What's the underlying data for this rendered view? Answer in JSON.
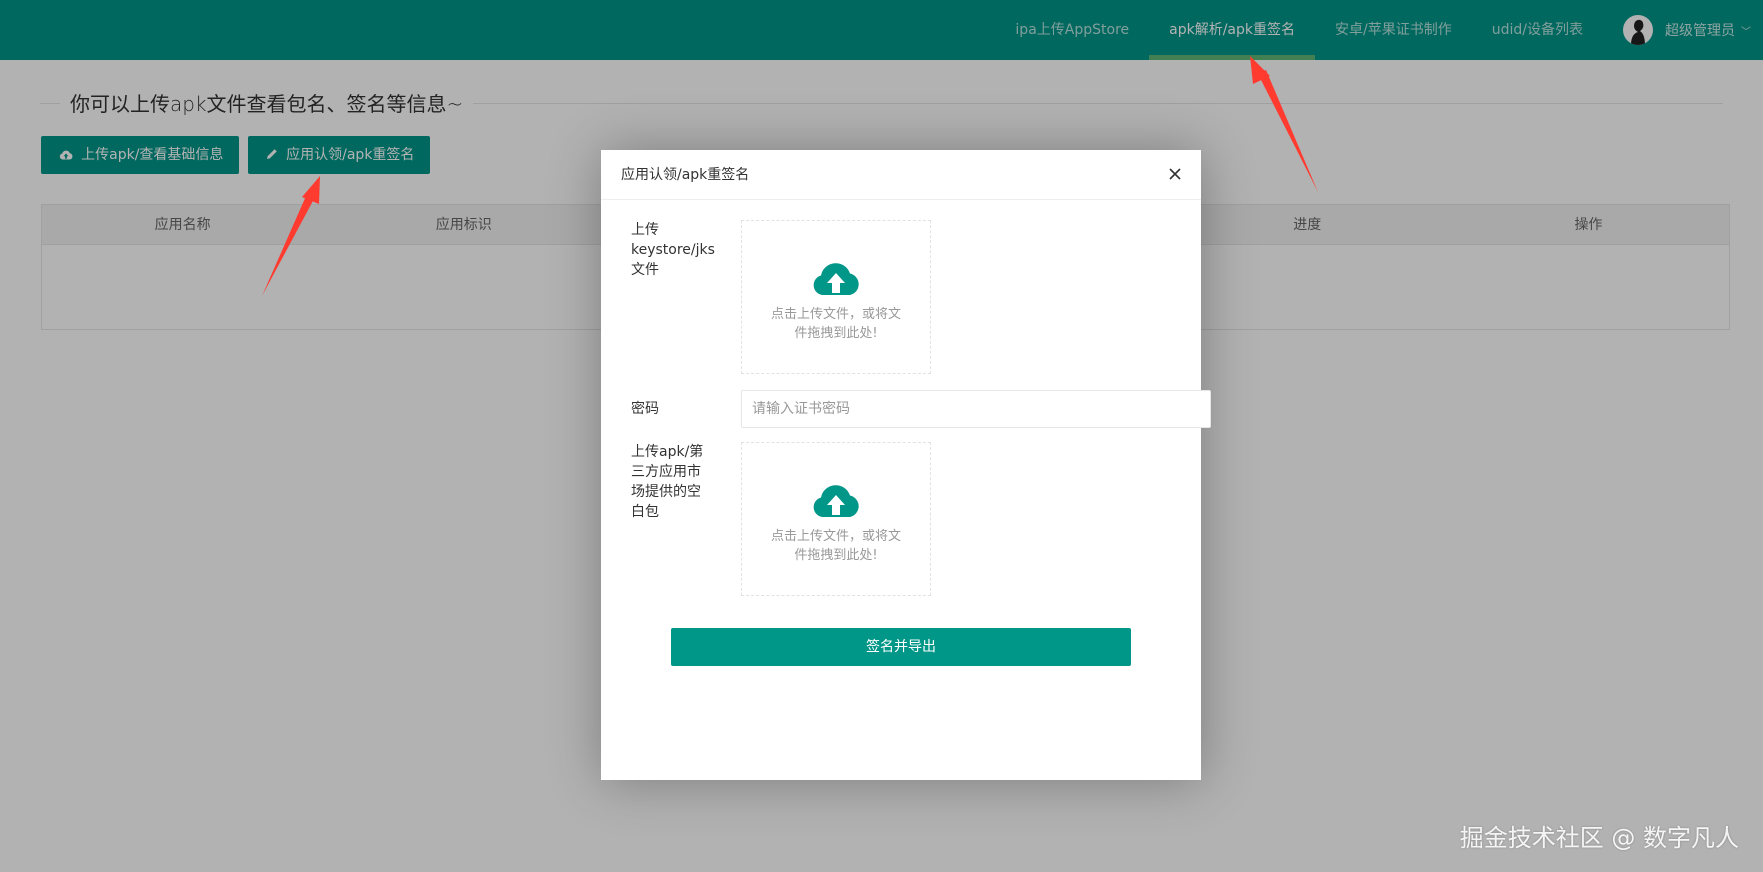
{
  "nav": {
    "items": [
      {
        "label": "ipa上传AppStore"
      },
      {
        "label": "apk解析/apk重签名"
      },
      {
        "label": "安卓/苹果证书制作"
      },
      {
        "label": "udid/设备列表"
      }
    ],
    "user_name": "超级管理员",
    "caret": "﹀"
  },
  "page": {
    "title": "你可以上传apk文件查看包名、签名等信息~",
    "buttons": {
      "upload_label": "上传apk/查看基础信息",
      "resign_label": "应用认领/apk重签名"
    },
    "table": {
      "headers": [
        "应用名称",
        "应用标识",
        "",
        "",
        "进度",
        "操作"
      ]
    }
  },
  "modal": {
    "title": "应用认领/apk重签名",
    "keystore_label": "上传keystore/jks文件",
    "dropzone_text": "点击上传文件，或将文件拖拽到此处!",
    "password_label": "密码",
    "password_placeholder": "请输入证书密码",
    "apk_label": "上传apk/第三方应用市场提供的空白包",
    "submit_label": "签名并导出"
  },
  "watermark": "掘金技术社区 @ 数字凡人",
  "colors": {
    "primary": "#009688",
    "nav_active_bar": "#5FB878",
    "arrow": "#FF3B30"
  }
}
